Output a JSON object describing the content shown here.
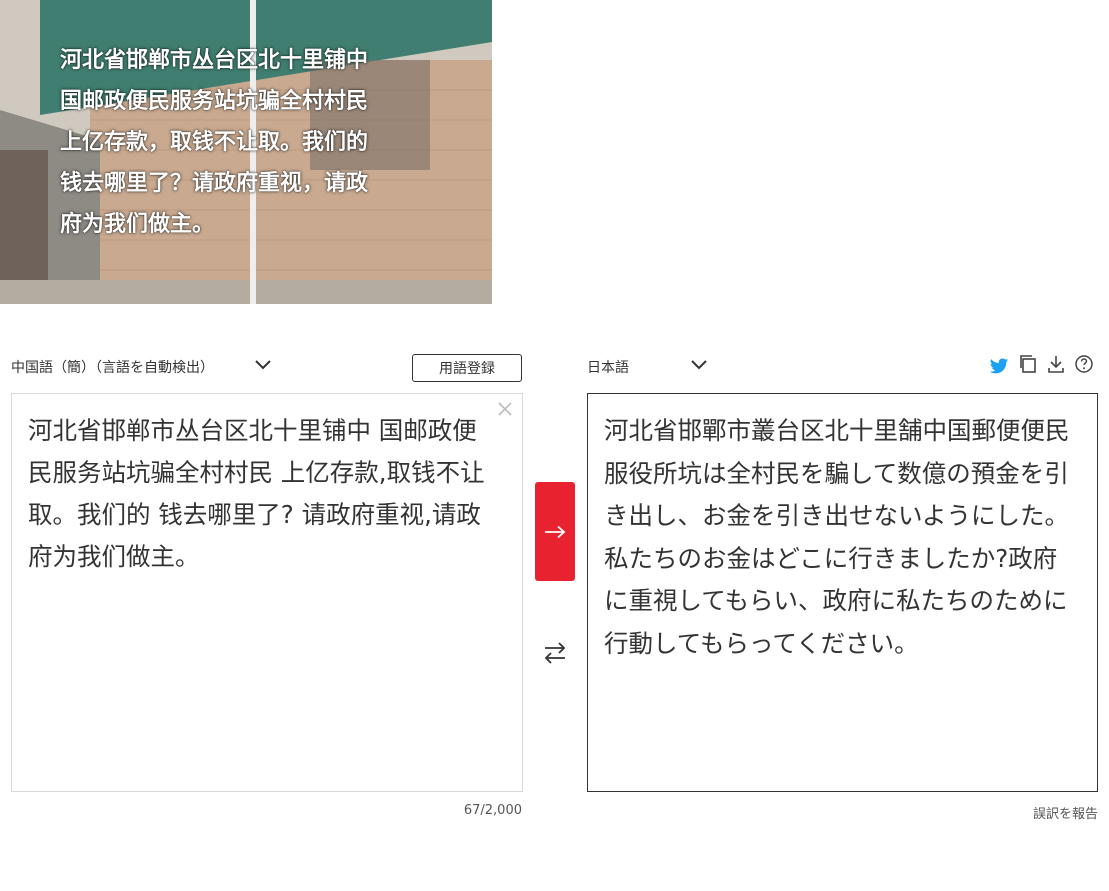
{
  "photo": {
    "caption": "河北省邯郸市丛台区北十里铺中\n国邮政便民服务站坑骗全村村民\n上亿存款，取钱不让取。我们的\n钱去哪里了？请政府重视，请政\n府为我们做主。"
  },
  "source": {
    "language_label": "中国語（簡）（言語を自動検出）",
    "text": "河北省邯郸市丛台区北十里铺中 国邮政便民服务站坑骗全村村民 上亿存款,取钱不让取。我们的 钱去哪里了? 请政府重视,请政府为我们做主。",
    "char_count": "67/2,000"
  },
  "toolbar": {
    "glossary_label": "用語登録"
  },
  "target": {
    "language_label": "日本語",
    "text": "河北省邯鄲市叢台区北十里舗中国郵便便民服役所坑は全村民を騙して数億の預金を引き出し、お金を引き出せないようにした。私たちのお金はどこに行きましたか?政府に重視してもらい、政府に私たちのために行動してもらってください。",
    "report_label": "誤訳を報告"
  },
  "icons": {
    "twitter": "twitter-icon",
    "copy": "copy-icon",
    "download": "download-icon",
    "help": "help-icon",
    "translate": "arrow-right-icon",
    "swap": "swap-icon",
    "clear": "close-icon"
  },
  "colors": {
    "accent": "#e8232f",
    "twitter": "#1da1f2"
  }
}
